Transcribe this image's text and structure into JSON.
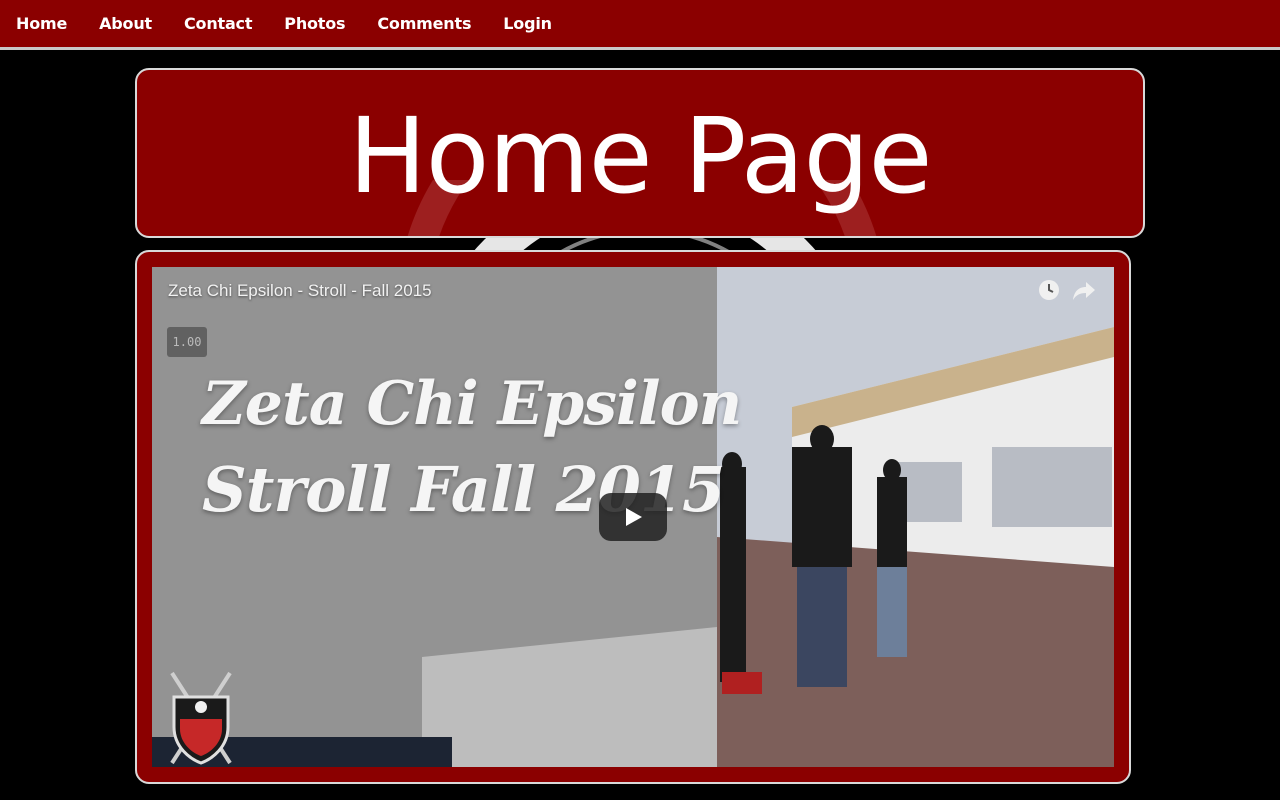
{
  "nav": {
    "items": [
      {
        "label": "Home"
      },
      {
        "label": "About"
      },
      {
        "label": "Contact"
      },
      {
        "label": "Photos"
      },
      {
        "label": "Comments"
      },
      {
        "label": "Login"
      }
    ]
  },
  "header": {
    "title": "Home Page"
  },
  "video": {
    "title": "Zeta Chi Epsilon - Stroll - Fall 2015",
    "speed": "1.00",
    "overlay_line1": "Zeta Chi Epsilon",
    "overlay_line2": "Stroll  Fall 2015",
    "icons": [
      "watch-later-icon",
      "share-icon",
      "play-icon"
    ]
  },
  "colors": {
    "brand": "#8b0000",
    "background": "#000000",
    "border": "#d9d9d9"
  }
}
